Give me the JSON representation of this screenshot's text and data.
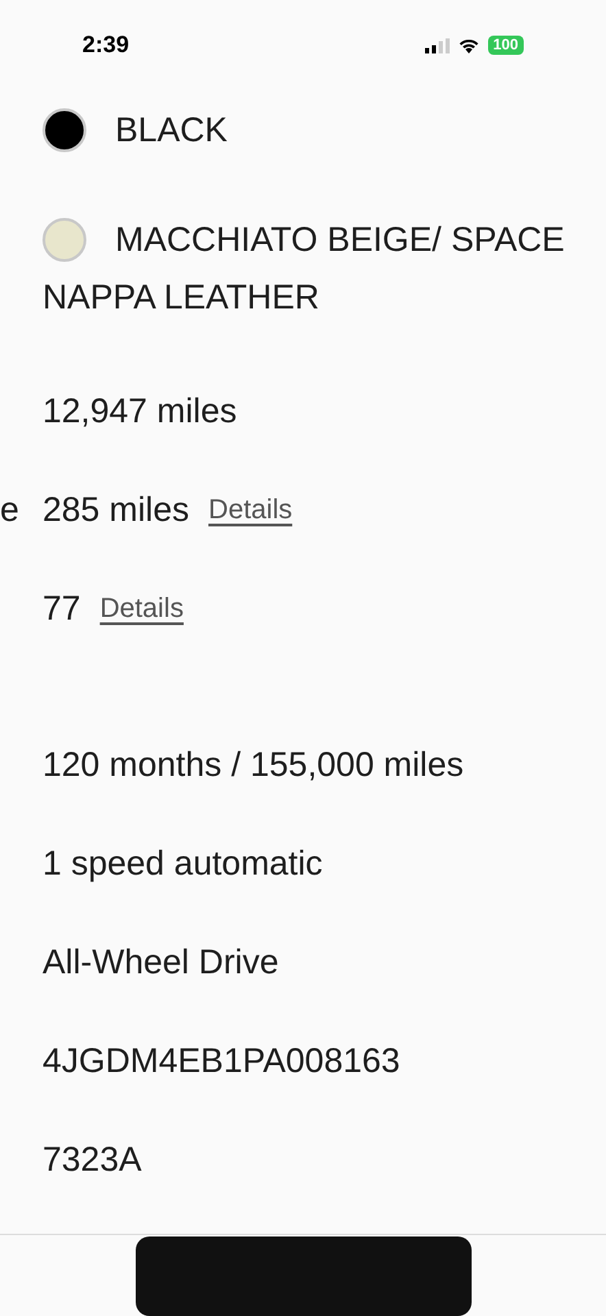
{
  "status_bar": {
    "time": "2:39",
    "battery": "100"
  },
  "colors": [
    {
      "name": "BLACK",
      "color": "#000000"
    },
    {
      "name": "MACCHIATO BEIGE/ SPACE NAPPA LEATHER",
      "color": "#e8e6cc"
    }
  ],
  "mileage": "12,947 miles",
  "range": {
    "side_label": "e",
    "value": "285 miles",
    "link": "Details"
  },
  "rating": {
    "value": "77",
    "link": "Details"
  },
  "specs": [
    "120 months / 155,000 miles",
    "1 speed automatic",
    "All-Wheel Drive",
    "4JGDM4EB1PA008163",
    "7323A"
  ]
}
